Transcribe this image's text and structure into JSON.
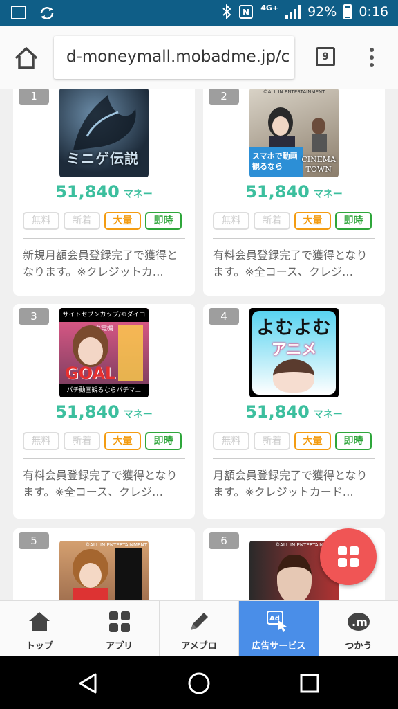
{
  "status_bar": {
    "network": "4G+",
    "battery": "92%",
    "time": "0:16"
  },
  "browser": {
    "url": "d-moneymall.mobadme.jp/c",
    "tab_count": "9"
  },
  "cards": [
    {
      "rank": "1",
      "image_text": "ミニゲ伝説",
      "price": "51,840",
      "unit": "マネー",
      "tags": [
        "無料",
        "新着",
        "大量",
        "即時"
      ],
      "desc": "新規月額会員登録完了で獲得となります。※クレジットカ…"
    },
    {
      "rank": "2",
      "image_copy": "©ALL IN ENTERTAINMENT",
      "image_banner": "スマホで動画観るなら",
      "image_logo1": "CINEMA",
      "image_logo2": "TOWN",
      "price": "51,840",
      "unit": "マネー",
      "tags": [
        "無料",
        "新着",
        "大量",
        "即時"
      ],
      "desc": "有料会員登録完了で獲得となります。※全コース、クレジ…"
    },
    {
      "rank": "3",
      "image_top": "サイトセブンカップ/©ダイコク電機",
      "image_goal": "GOAL",
      "image_bottom": "パチ動画観るならパチマニ",
      "price": "51,840",
      "unit": "マネー",
      "tags": [
        "無料",
        "新着",
        "大量",
        "即時"
      ],
      "desc": "有料会員登録完了で獲得となります。※全コース、クレジ…"
    },
    {
      "rank": "4",
      "image_line1": "よむよむ",
      "image_line2": "アニメ",
      "price": "51,840",
      "unit": "マネー",
      "tags": [
        "無料",
        "新着",
        "大量",
        "即時"
      ],
      "desc": "月額会員登録完了で獲得となります。※クレジットカード…"
    },
    {
      "rank": "5",
      "image_copy": "©ALL IN ENTERTAINMENT"
    },
    {
      "rank": "6",
      "image_copy": "©ALL IN ENTERTAINMENT"
    }
  ],
  "bottom_nav": [
    {
      "label": "トップ",
      "icon": "home-icon"
    },
    {
      "label": "アプリ",
      "icon": "apps-grid-icon"
    },
    {
      "label": "アメブロ",
      "icon": "pencil-icon"
    },
    {
      "label": "広告サービス",
      "icon": "ad-touch-icon",
      "active": true
    },
    {
      "label": "つかう",
      "icon": "money-icon"
    }
  ],
  "colors": {
    "status_bar": "#0f5e87",
    "price": "#3cbf9e",
    "tag_orange": "#f39c12",
    "tag_green": "#2ea63a",
    "fab": "#f05555",
    "active_nav": "#4a8ee8"
  }
}
